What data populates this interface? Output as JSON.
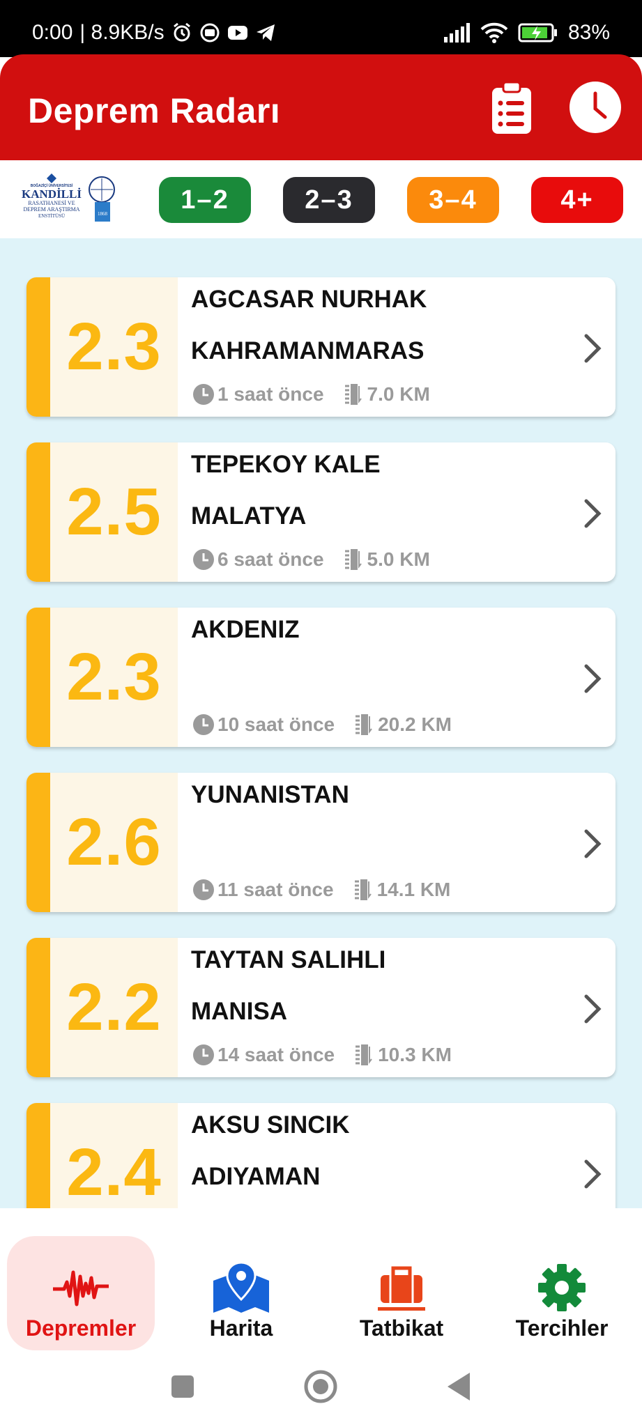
{
  "status_bar": {
    "time": "0:00",
    "speed": "| 8.9KB/s",
    "battery": "83%"
  },
  "app": {
    "title": "Deprem Radarı"
  },
  "filters": [
    {
      "label": "1–2",
      "color": "#1a8a3a"
    },
    {
      "label": "2–3",
      "color": "#2a2a2e"
    },
    {
      "label": "3–4",
      "color": "#fb8a0c"
    },
    {
      "label": "4+",
      "color": "#e80c0c"
    }
  ],
  "logo": {
    "line1": "BOĞAZİÇİ ÜNİVERSİTESİ",
    "line2": "KANDİLLİ",
    "line3": "RASATHANESİ VE",
    "line4": "DEPREM ARAŞTIRMA",
    "line5": "ENSTİTÜSÜ",
    "year": "1868"
  },
  "earthquakes": [
    {
      "magnitude": "2.3",
      "location_line1": "AGCASAR NURHAK",
      "location_line2": "KAHRAMANMARAS",
      "time_ago": "1 saat önce",
      "depth": "7.0 KM"
    },
    {
      "magnitude": "2.5",
      "location_line1": "TEPEKOY KALE",
      "location_line2": "MALATYA",
      "time_ago": "6 saat önce",
      "depth": "5.0 KM"
    },
    {
      "magnitude": "2.3",
      "location_line1": "AKDENIZ",
      "location_line2": "",
      "time_ago": "10 saat önce",
      "depth": "20.2 KM"
    },
    {
      "magnitude": "2.6",
      "location_line1": "YUNANISTAN",
      "location_line2": "",
      "time_ago": "11 saat önce",
      "depth": "14.1 KM"
    },
    {
      "magnitude": "2.2",
      "location_line1": "TAYTAN SALIHLI",
      "location_line2": "MANISA",
      "time_ago": "14 saat önce",
      "depth": "10.3 KM"
    },
    {
      "magnitude": "2.4",
      "location_line1": "AKSU SINCIK",
      "location_line2": "ADIYAMAN",
      "time_ago": "",
      "depth": ""
    }
  ],
  "bottom_nav": [
    {
      "label": "Depremler",
      "icon": "seismograph-icon",
      "active": true
    },
    {
      "label": "Harita",
      "icon": "map-pin-icon",
      "active": false
    },
    {
      "label": "Tatbikat",
      "icon": "emergency-bag-icon",
      "active": false
    },
    {
      "label": "Tercihler",
      "icon": "gear-icon",
      "active": false
    }
  ],
  "colors": {
    "primary_red": "#d10f0f",
    "magnitude_yellow": "#fbb812",
    "list_background": "#dff3f9"
  }
}
